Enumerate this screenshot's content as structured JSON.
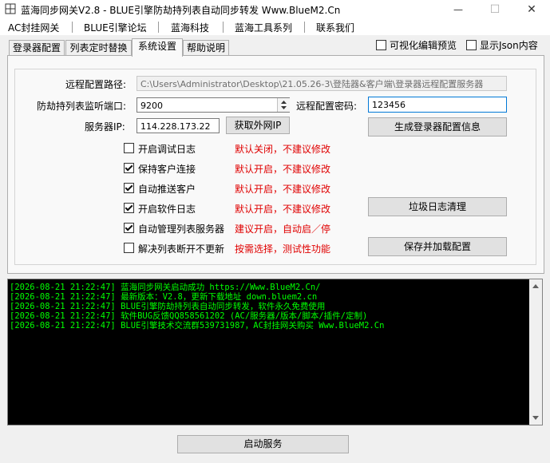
{
  "window": {
    "title": "蓝海同步网关V2.8 - BLUE引擎防劫持列表自动同步转发 Www.BlueM2.Cn",
    "minimize_glyph": "—",
    "maximize_glyph": "☐",
    "close_glyph": "✕"
  },
  "menubar": {
    "items": [
      {
        "label": "AC封挂网关"
      },
      {
        "label": "BLUE引擎论坛"
      },
      {
        "label": "蓝海科技"
      },
      {
        "label": "蓝海工具系列"
      },
      {
        "label": "联系我们"
      }
    ]
  },
  "tabs": [
    {
      "label": "登录器配置"
    },
    {
      "label": "列表定时替换"
    },
    {
      "label": "系统设置",
      "active": true
    },
    {
      "label": "帮助说明"
    }
  ],
  "options": {
    "visual_edit_preview": "可视化编辑预览",
    "show_json": "显示Json内容"
  },
  "form": {
    "remote_path_label": "远程配置路径:",
    "remote_path_value": "C:\\Users\\Administrator\\Desktop\\21.05.26-3\\登陆器&客户端\\登录器远程配置服务器",
    "port_label": "防劫持列表监听端口:",
    "port_value": "9200",
    "remote_password_label": "远程配置密码:",
    "remote_password_value": "123456",
    "server_ip_label": "服务器IP:",
    "server_ip_value": "114.228.173.22",
    "get_ip_button": "获取外网IP",
    "generate_button": "生成登录器配置信息",
    "clean_log_button": "垃圾日志清理",
    "save_reload_button": "保存并加载配置"
  },
  "settings": [
    {
      "label": "开启调试日志",
      "checked": false,
      "note": "默认关闭，不建议修改"
    },
    {
      "label": "保持客户连接",
      "checked": true,
      "note": "默认开启，不建议修改"
    },
    {
      "label": "自动推送客户",
      "checked": true,
      "note": "默认开启，不建议修改"
    },
    {
      "label": "开启软件日志",
      "checked": true,
      "note": "默认开启，不建议修改"
    },
    {
      "label": "自动管理列表服务器",
      "checked": true,
      "note": "建议开启，自动启／停"
    },
    {
      "label": "解决列表断开不更新",
      "checked": false,
      "note": "按需选择，测试性功能"
    }
  ],
  "log": [
    "[2026-08-21 21:22:47] 蓝海同步网关启动成功 https://Www.BlueM2.Cn/",
    "[2026-08-21 21:22:47] 最新版本：V2.8，更新下载地址 down.bluem2.cn",
    "[2026-08-21 21:22:47] BLUE引擎防劫持列表自动同步转发，软件永久免费使用",
    "[2026-08-21 21:22:47] 软件BUG反馈QQ858561202 (AC/服务器/版本/脚本/插件/定制)",
    "[2026-08-21 21:22:47] BLUE引擎技术交流群539731987，AC封挂网关购买 Www.BlueM2.Cn"
  ],
  "start_button": "启动服务",
  "colors": {
    "log_text": "#00ff00",
    "log_bg": "#000000",
    "note_red": "#e00000",
    "focus_border": "#0078d7"
  }
}
